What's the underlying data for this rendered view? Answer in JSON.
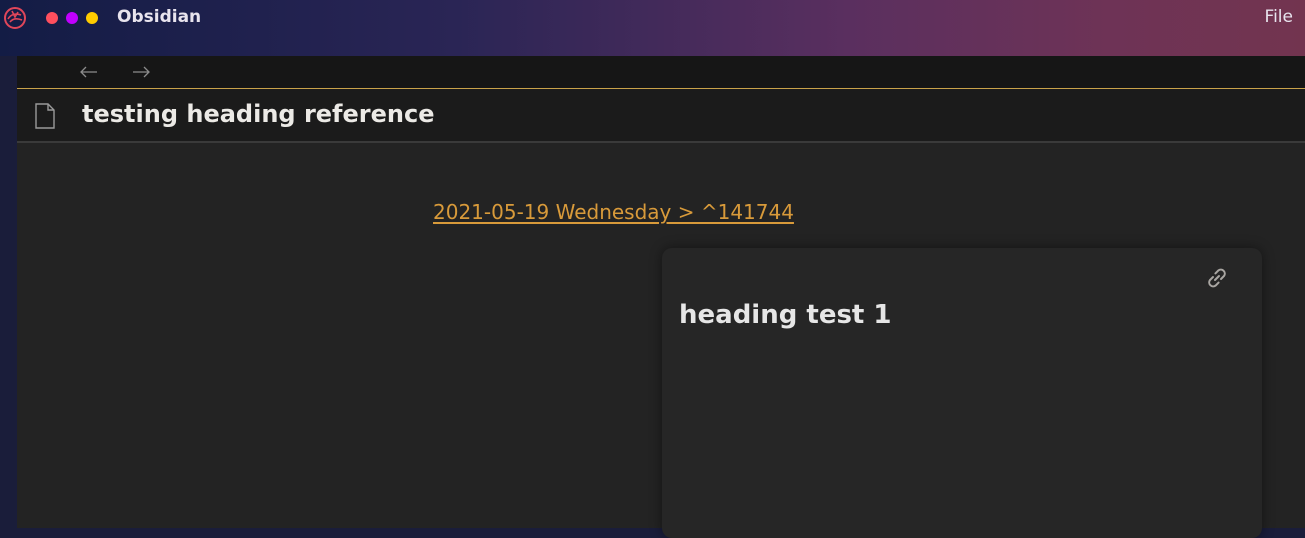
{
  "app": {
    "title": "Obsidian",
    "menu": {
      "file_label": "File"
    },
    "logo_icon": "obsidian-logo-icon",
    "window_controls": [
      {
        "name": "close",
        "color": "#ff4f5e"
      },
      {
        "name": "minimize",
        "color": "#c100ff"
      },
      {
        "name": "maximize",
        "color": "#ffcc00"
      }
    ]
  },
  "nav": {
    "back_icon": "arrow-left-icon",
    "forward_icon": "arrow-right-icon"
  },
  "note": {
    "title": "testing heading reference",
    "file_icon": "document-icon",
    "embed_link_text": "2021-05-19 Wednesday > ^141744",
    "embed": {
      "heading": "heading test 1",
      "link_icon": "link-icon"
    }
  },
  "colors": {
    "accent": "#d89a3a",
    "pane_background": "#232323",
    "header_background": "#1b1b1b",
    "navbar_background": "#161616",
    "embed_background": "#262626",
    "active_border": "#c9a24a"
  }
}
